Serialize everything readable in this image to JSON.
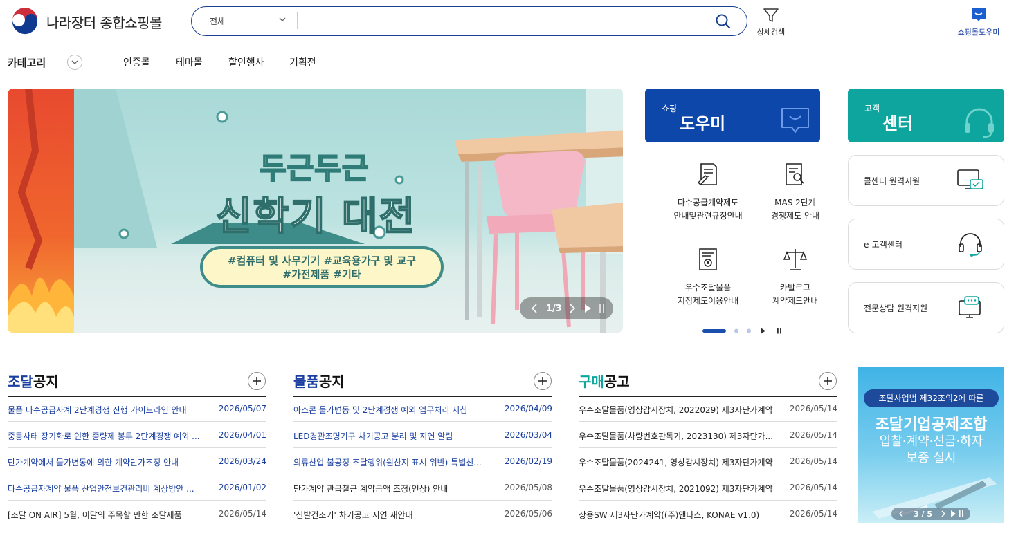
{
  "header": {
    "logo_text": "나라장터 종합쇼핑몰",
    "search_category": "전체",
    "search_placeholder": "",
    "advanced_search_label": "상세검색",
    "shopping_helper_label": "쇼핑몰도우미"
  },
  "nav": {
    "category_label": "카테고리",
    "items": [
      "인증몰",
      "테마몰",
      "할인행사",
      "기획전"
    ]
  },
  "banner": {
    "title_line1": "두근두근",
    "title_line2": "신학기 대전",
    "tags_line1": "#컴퓨터 및 사무기기  #교육용가구 및 교구",
    "tags_line2": "#가전제품  #기타",
    "pager": "1/3"
  },
  "shopping_helper": {
    "small": "쇼핑",
    "big": "도우미",
    "items": [
      {
        "line1": "다수공급계약제도",
        "line2": "안내및관련규정안내",
        "icon": "document-pen-icon"
      },
      {
        "line1": "MAS 2단계",
        "line2": "경쟁제도 안내",
        "icon": "document-search-icon"
      },
      {
        "line1": "우수조달물품",
        "line2": "지정제도이용안내",
        "icon": "certificate-icon"
      },
      {
        "line1": "카탈로그",
        "line2": "계약제도안내",
        "icon": "scale-icon"
      }
    ]
  },
  "customer_center": {
    "small": "고객",
    "big": "센터",
    "items": [
      {
        "label": "콜센터 원격지원",
        "icon": "remote-support-icon"
      },
      {
        "label": "e-고객센터",
        "icon": "headset-icon"
      },
      {
        "label": "전문상담 원격지원",
        "icon": "consult-monitor-icon"
      }
    ]
  },
  "notices": [
    {
      "title_accent": "조달",
      "title_rest": "공지",
      "accent_color": "#1a3fa0",
      "rows": [
        {
          "text": "물품 다수공급자계 2단계경쟁 진행 가이드라인 안내",
          "date": "2026/05/07",
          "highlight": true
        },
        {
          "text": "중동사태 장기화로 인한 종량제 봉투 2단계경쟁 예외 ...",
          "date": "2026/04/01",
          "highlight": true
        },
        {
          "text": "단가계약에서 물가변동에 의한 계약단가조정 안내",
          "date": "2026/03/24",
          "highlight": true
        },
        {
          "text": "다수공급자계약 물품 산업안전보건관리비 계상방안 ...",
          "date": "2026/01/02",
          "highlight": true
        },
        {
          "text": "[조달 ON AIR] 5월, 이달의 주목할 만한 조달제품",
          "date": "2026/05/14",
          "highlight": false
        }
      ]
    },
    {
      "title_accent": "물품",
      "title_rest": "공지",
      "accent_color": "#1a3fa0",
      "rows": [
        {
          "text": "아스콘 물가변동 및 2단계경쟁 예외 업무처리 지침",
          "date": "2026/04/09",
          "highlight": true
        },
        {
          "text": "LED경관조명기구 차기공고 분리 및 지연 알림",
          "date": "2026/03/04",
          "highlight": true
        },
        {
          "text": "의류산업 불공정 조달행위(원산지 표시 위반) 특별신...",
          "date": "2026/02/19",
          "highlight": true
        },
        {
          "text": "단가계약 관급철근 계약금액 조정(인상) 안내",
          "date": "2026/05/08",
          "highlight": false
        },
        {
          "text": "'신발건조기' 차기공고 지연 재안내",
          "date": "2026/05/06",
          "highlight": false
        }
      ]
    },
    {
      "title_accent": "구매",
      "title_rest": "공고",
      "accent_color": "#0fa59f",
      "rows": [
        {
          "text": "우수조달물품(영상감시장치, 2022029) 제3자단가계약",
          "date": "2026/05/14",
          "highlight": false
        },
        {
          "text": "우수조달물품(차량번호판독기, 2023130) 제3자단가...",
          "date": "2026/05/14",
          "highlight": false
        },
        {
          "text": "우수조달물품(2024241, 영상감시장치) 제3자단가계약",
          "date": "2026/05/14",
          "highlight": false
        },
        {
          "text": "우수조달물품(영상감시장치, 2021092) 제3자단가계약",
          "date": "2026/05/14",
          "highlight": false
        },
        {
          "text": "상용SW 제3자단가계약((주)앤다스, KONAE v1.0)",
          "date": "2026/05/14",
          "highlight": false
        }
      ]
    }
  ],
  "side_ad": {
    "pill": "조달사업법 제32조의2에 따른",
    "title": "조달기업공제조합",
    "line1": "입찰·계약·선금·하자",
    "line2": "보증 실시",
    "pager": "3 / 5"
  },
  "colors": {
    "brand_blue": "#0d47a9",
    "teal": "#0fa59f",
    "notice_link": "#1a3fa0"
  }
}
